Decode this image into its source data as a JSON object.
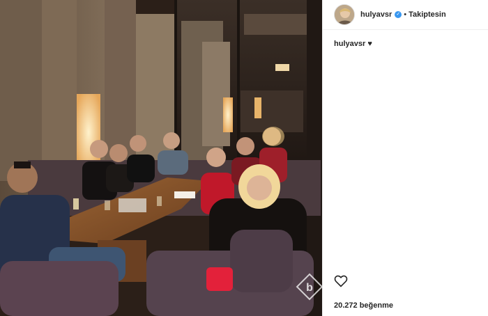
{
  "post": {
    "username": "hulyavsr",
    "follow_status": "Takiptesin",
    "separator": "•",
    "verified": true,
    "caption_username": "hulyavsr",
    "caption_text": "♥",
    "likes_text": "20.272 beğenme"
  },
  "icons": [
    "avatar",
    "verified-badge-icon",
    "heart-icon",
    "watermark-b-icon"
  ],
  "colors": {
    "verified": "#3897f0",
    "text": "#262626",
    "border": "#efefef"
  }
}
